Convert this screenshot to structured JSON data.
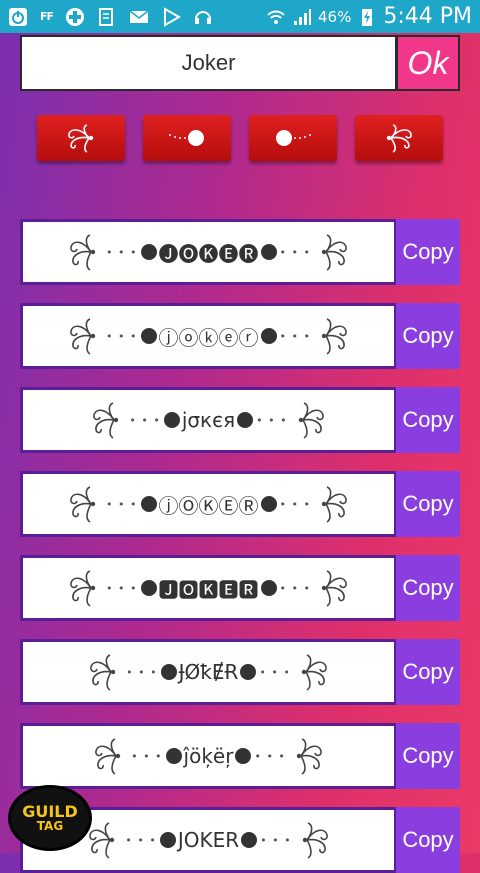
{
  "status_bar": {
    "ff_label": "FF",
    "battery": "46%",
    "time": "5:44 PM",
    "color": "#1fa7c9"
  },
  "input": {
    "value": "Joker"
  },
  "ok_button": {
    "label": "Ok"
  },
  "symbol_buttons": [
    {
      "name": "swirl-ornament-left"
    },
    {
      "name": "dots-ball-right"
    },
    {
      "name": "ball-dots-left"
    },
    {
      "name": "swirl-ornament-right"
    }
  ],
  "rows": [
    {
      "text": "🅙🅞🅚🅔🅡",
      "copy_label": "Copy"
    },
    {
      "text": "ⓙⓞⓚⓔⓡ",
      "copy_label": "Copy"
    },
    {
      "text": "jσкєя",
      "copy_label": "Copy"
    },
    {
      "text": "ⓙⓄⓀⒺⓇ",
      "copy_label": "Copy"
    },
    {
      "text": "🅹🅾🅺🅴🆁",
      "copy_label": "Copy"
    },
    {
      "text": "ɈØꝁɆɌ",
      "copy_label": "Copy"
    },
    {
      "text": "ĵöķëŗ",
      "copy_label": "Copy"
    },
    {
      "text": "JOKER",
      "copy_label": "Copy"
    }
  ],
  "watermark": {
    "line1": "GUILD",
    "line2": "TAG"
  }
}
